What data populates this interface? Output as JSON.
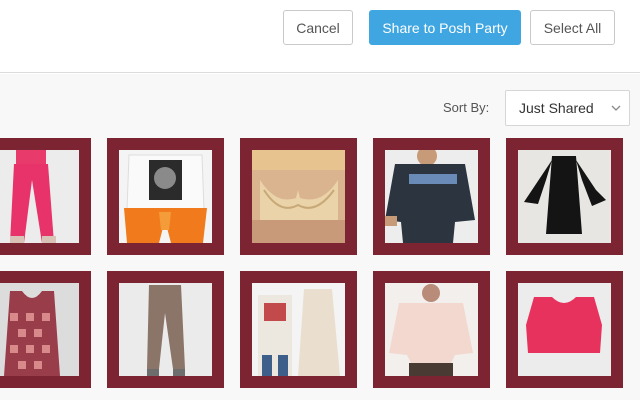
{
  "toolbar": {
    "cancel_label": "Cancel",
    "share_label": "Share to Posh Party",
    "select_all_label": "Select All"
  },
  "sort": {
    "label": "Sort By:",
    "selected": "Just Shared"
  },
  "colors": {
    "accent": "#3fa6e2",
    "tile_border": "#7c2432"
  },
  "listings": [
    {
      "id": "pink-leggings",
      "description": "pink leggings"
    },
    {
      "id": "graphic-tee-orange-pants",
      "description": "graphic tee with orange pants"
    },
    {
      "id": "lace-bralette",
      "description": "tan lace bralette"
    },
    {
      "id": "led-zeppelin-sweatshirt",
      "description": "black band sweatshirt"
    },
    {
      "id": "black-bell-sleeve-dress",
      "description": "black bell sleeve dress"
    },
    {
      "id": "patterned-tank",
      "description": "patterned sleeveless top"
    },
    {
      "id": "taupe-joggers",
      "description": "taupe joggers"
    },
    {
      "id": "long-tee-dress",
      "description": "long tee dress"
    },
    {
      "id": "pink-knit-sweater",
      "description": "light pink knit sweater"
    },
    {
      "id": "pink-crop-tank",
      "description": "pink crop tank"
    }
  ]
}
